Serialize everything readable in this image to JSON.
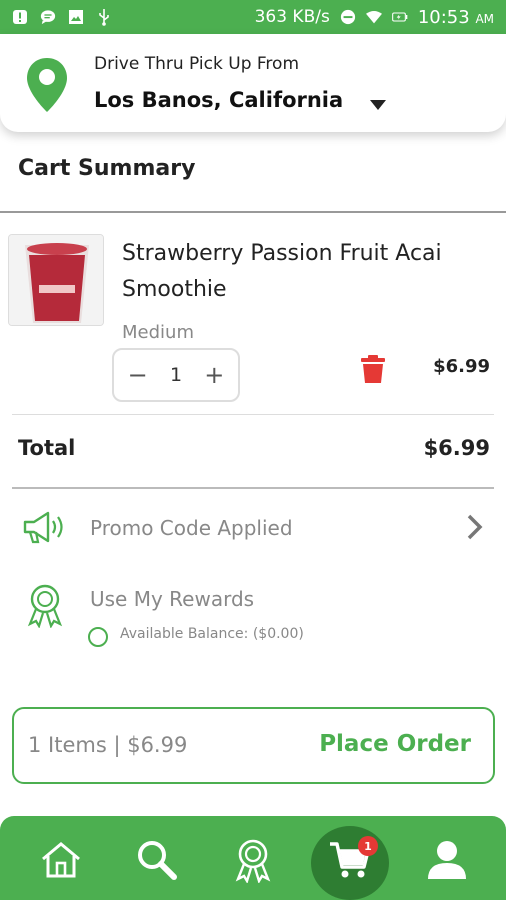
{
  "status_bar": {
    "speed": "363 KB/s",
    "time": "10:53",
    "ampm": "AM",
    "icons": [
      "notification-icon",
      "message-icon",
      "image-icon",
      "usb-icon",
      "dnd-icon",
      "wifi-icon",
      "battery-icon"
    ]
  },
  "header": {
    "subtitle": "Drive Thru Pick Up From",
    "location": "Los Banos, California"
  },
  "cart": {
    "title": "Cart Summary",
    "item": {
      "name": "Strawberry Passion Fruit Acai Smoothie",
      "size": "Medium",
      "quantity": "1",
      "minus": "−",
      "plus": "+",
      "price": "$6.99"
    },
    "total_label": "Total",
    "total_value": "$6.99"
  },
  "promo": {
    "label": "Promo Code Applied"
  },
  "rewards": {
    "label": "Use My Rewards",
    "balance": "Available Balance: ($0.00)"
  },
  "order": {
    "summary": "1 Items | $6.99",
    "button": "Place Order"
  },
  "nav": {
    "items": [
      "home-icon",
      "search-icon",
      "rewards-icon",
      "cart-icon",
      "profile-icon"
    ],
    "cart_badge": "1"
  },
  "colors": {
    "brand_green": "#4caf50",
    "dark_green": "#2e7d32",
    "delete_red": "#e53935"
  }
}
